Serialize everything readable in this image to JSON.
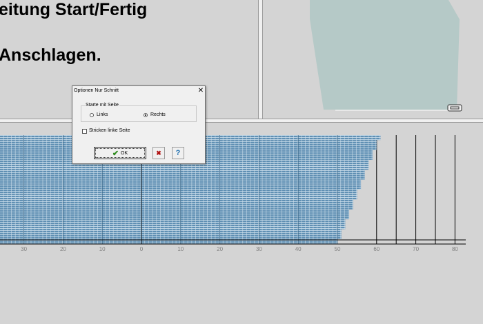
{
  "headings": {
    "line1": "eitung Start/Fertig",
    "line2": "Anschlagen."
  },
  "dialog": {
    "title": "Optionen Nur Schnitt",
    "group_label": "Starte mit Seite",
    "radio_left": "Links",
    "radio_right": "Rechts",
    "selected": "Rechts",
    "checkbox_label": "Stricken linke Seite",
    "checkbox_checked": false,
    "ok_label": "OK",
    "cancel_glyph": "✖",
    "help_glyph": "?"
  },
  "chart_data": {
    "type": "area",
    "axis_ticks": [
      30,
      20,
      10,
      0,
      10,
      20,
      30,
      40,
      50,
      60,
      70,
      80
    ],
    "fill_color": "#5f8fb3",
    "row_edges": [
      [
        61,
        60
      ],
      [
        60,
        59
      ],
      [
        59,
        58
      ],
      [
        58,
        57
      ],
      [
        57,
        56
      ],
      [
        56,
        55
      ],
      [
        55,
        54
      ],
      [
        54,
        53
      ],
      [
        53,
        52
      ],
      [
        52,
        51
      ],
      [
        51,
        50
      ]
    ]
  },
  "colors": {
    "background": "#d4d4d4",
    "preview_shape": "#b5c9c7",
    "ok_check": "#2e8b1e",
    "cancel_x": "#b01010",
    "help_q": "#1e6fb0"
  }
}
